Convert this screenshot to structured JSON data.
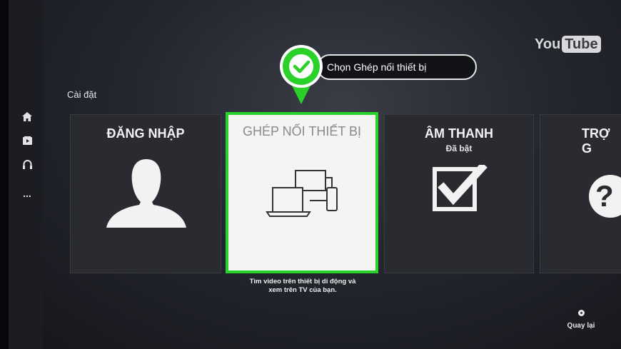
{
  "app": {
    "logo_you": "You",
    "logo_tube": "Tube"
  },
  "sidebar": {
    "items": [
      {
        "icon": "home-icon"
      },
      {
        "icon": "subscriptions-icon"
      },
      {
        "icon": "headphones-icon"
      },
      {
        "icon": "more-icon",
        "label": "..."
      }
    ]
  },
  "section": {
    "title": "Cài đặt"
  },
  "callout": {
    "text": "Chọn Ghép nối thiết bị",
    "icon": "checkmark-icon",
    "color": "#29d128"
  },
  "cards": [
    {
      "title": "ĐĂNG NHẬP",
      "icon": "person-silhouette-icon"
    },
    {
      "title": "GHÉP NỐI THIẾT BỊ",
      "icon": "devices-icon",
      "selected": true,
      "description_line1": "Tìm video trên thiết bị di động và",
      "description_line2": "xem trên TV của bạn."
    },
    {
      "title": "ÂM THANH",
      "subtitle": "Đã bật",
      "icon": "checkbox-checked-icon"
    },
    {
      "title": "TRỢ G",
      "icon": "help-icon",
      "help_glyph": "?"
    }
  ],
  "footer": {
    "back_label": "Quay lại",
    "back_icon": "dot-button-icon"
  },
  "colors": {
    "accent_green": "#29d128",
    "card_bg": "#2a2b30",
    "selected_bg": "#f4f4f2"
  }
}
